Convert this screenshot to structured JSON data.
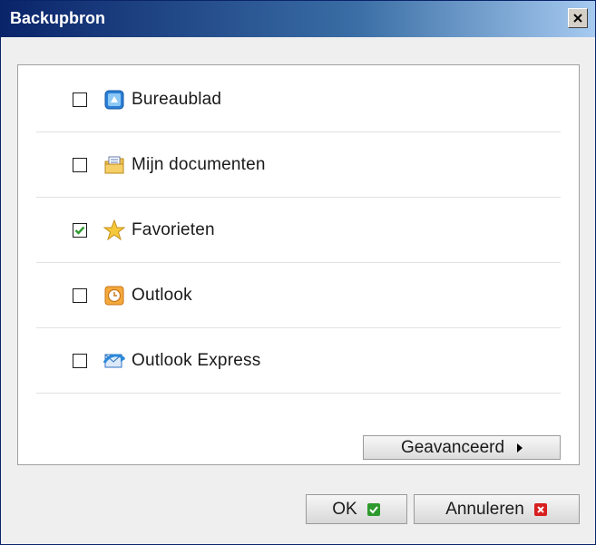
{
  "window": {
    "title": "Backupbron",
    "close_icon": "close-icon"
  },
  "sources": [
    {
      "label": "Bureaublad",
      "checked": false,
      "icon": "desktop-icon"
    },
    {
      "label": "Mijn documenten",
      "checked": false,
      "icon": "documents-icon"
    },
    {
      "label": "Favorieten",
      "checked": true,
      "icon": "star-icon"
    },
    {
      "label": "Outlook",
      "checked": false,
      "icon": "outlook-clock-icon"
    },
    {
      "label": "Outlook Express",
      "checked": false,
      "icon": "outlook-express-icon"
    }
  ],
  "buttons": {
    "advanced_label": "Geavanceerd",
    "ok_label": "OK",
    "cancel_label": "Annuleren"
  },
  "colors": {
    "titlebar": "#0a246a",
    "check_green": "#2e9a2e",
    "cancel_red": "#d81e1e"
  }
}
